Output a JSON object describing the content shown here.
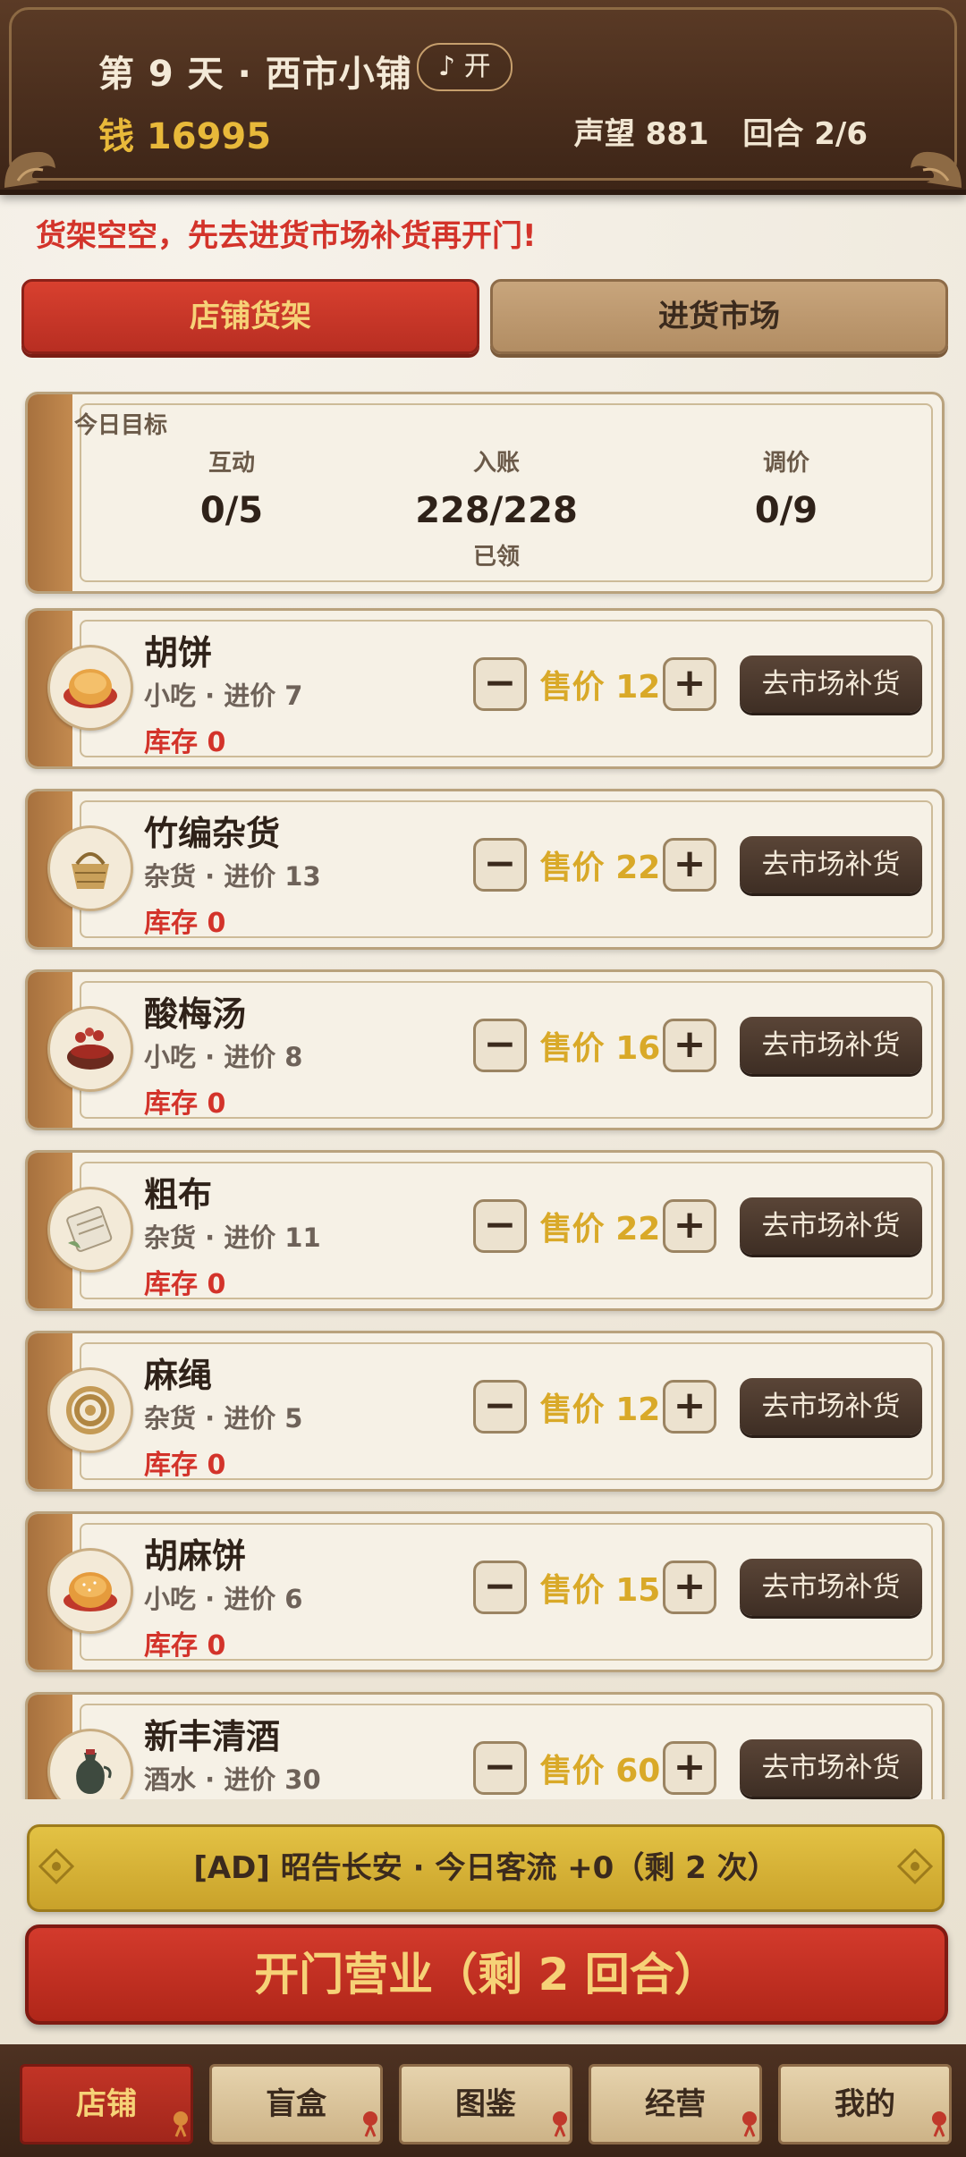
{
  "header": {
    "title": "第 9 天 · 西市小铺",
    "music_label": "♪ 开",
    "money": "钱 16995",
    "reputation": "声望 881",
    "round": "回合 2/6"
  },
  "warning": "货架空空，先去进货市场补货再开门!",
  "tabs": {
    "shop": "店铺货架",
    "market": "进货市场"
  },
  "goal": {
    "label": "今日目标",
    "interact": {
      "title": "互动",
      "value": "0/5"
    },
    "income": {
      "title": "入账",
      "value": "228/228",
      "status": "已领"
    },
    "price_adjust": {
      "title": "调价",
      "value": "0/9"
    }
  },
  "products": [
    {
      "name": "胡饼",
      "meta": "小吃 · 进价 7",
      "stock": "库存 0",
      "price": "售价 12",
      "action": "去市场补货",
      "icon": "flatbread-icon"
    },
    {
      "name": "竹编杂货",
      "meta": "杂货 · 进价 13",
      "stock": "库存 0",
      "price": "售价 22",
      "action": "去市场补货",
      "icon": "bamboo-basket-icon"
    },
    {
      "name": "酸梅汤",
      "meta": "小吃 · 进价 8",
      "stock": "库存 0",
      "price": "售价 16",
      "action": "去市场补货",
      "icon": "plum-soup-icon"
    },
    {
      "name": "粗布",
      "meta": "杂货 · 进价 11",
      "stock": "库存 0",
      "price": "售价 22",
      "action": "去市场补货",
      "icon": "cloth-roll-icon"
    },
    {
      "name": "麻绳",
      "meta": "杂货 · 进价 5",
      "stock": "库存 0",
      "price": "售价 12",
      "action": "去市场补货",
      "icon": "rope-icon"
    },
    {
      "name": "胡麻饼",
      "meta": "小吃 · 进价 6",
      "stock": "库存 0",
      "price": "售价 15",
      "action": "去市场补货",
      "icon": "sesame-cake-icon"
    },
    {
      "name": "新丰清酒",
      "meta": "酒水 · 进价 30",
      "stock": "",
      "price": "售价 60",
      "action": "去市场补货",
      "icon": "wine-jug-icon"
    }
  ],
  "buttons": {
    "ad": "[AD] 昭告长安 · 今日客流 +0（剩 2 次）",
    "open": "开门营业（剩 2 回合）",
    "minus": "−",
    "plus": "+"
  },
  "nav": [
    "店铺",
    "盲盒",
    "图鉴",
    "经营",
    "我的"
  ],
  "colors": {
    "header_bg": "#4a2e1d",
    "accent_red": "#c23426",
    "gold": "#d9a928",
    "warning_red": "#d3332a"
  }
}
